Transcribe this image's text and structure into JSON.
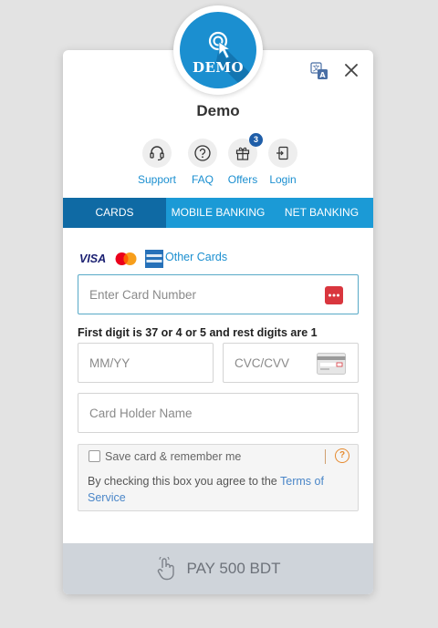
{
  "logo": {
    "text": "DEMO"
  },
  "header": {
    "merchant_name": "Demo",
    "translate_icon": "translate-icon",
    "close_icon": "close-icon"
  },
  "quick_links": [
    {
      "label": "Support",
      "icon": "headset-icon"
    },
    {
      "label": "FAQ",
      "icon": "question-icon"
    },
    {
      "label": "Offers",
      "icon": "gift-icon",
      "badge": "3"
    },
    {
      "label": "Login",
      "icon": "login-icon"
    }
  ],
  "tabs": [
    {
      "label": "CARDS",
      "active": true
    },
    {
      "label": "MOBILE BANKING",
      "active": false
    },
    {
      "label": "NET BANKING",
      "active": false
    }
  ],
  "card_form": {
    "brands": {
      "visa": "VISA"
    },
    "other_cards_label": "Other Cards",
    "card_number_placeholder": "Enter Card Number",
    "hint": "First digit is 37 or 4 or 5 and rest digits are 1",
    "expiry_placeholder": "MM/YY",
    "cvc_placeholder": "CVC/CVV",
    "holder_placeholder": "Card Holder Name",
    "save_label": "Save card & remember me",
    "agree_text": "By checking this box you agree to the ",
    "terms_link": "Terms of Service"
  },
  "pay": {
    "label": "PAY 500 BDT",
    "icon": "hand-pointer-icon"
  },
  "colors": {
    "primary": "#1b9ad6",
    "active_tab": "#0f6aa4",
    "link": "#1b8fd0",
    "pay_bg": "#cfd4da"
  }
}
